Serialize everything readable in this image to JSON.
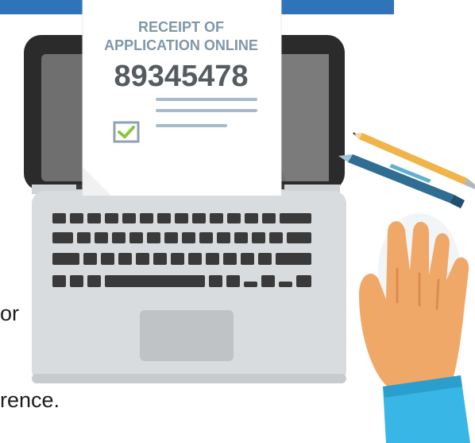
{
  "receipt": {
    "title_line1": "RECEIPT OF",
    "title_line2": "APPLICATION ONLINE",
    "number": "89345478",
    "check_icon": "check-icon"
  },
  "text_fragments": {
    "line1_tail": "or",
    "line2_tail": "rence."
  },
  "colors": {
    "top_bar": "#2f73b8",
    "receipt_text": "#7f97a8",
    "receipt_number": "#555c60",
    "check": "#8cc63f",
    "sleeve": "#38b6e6",
    "skin": "#f0a868"
  }
}
